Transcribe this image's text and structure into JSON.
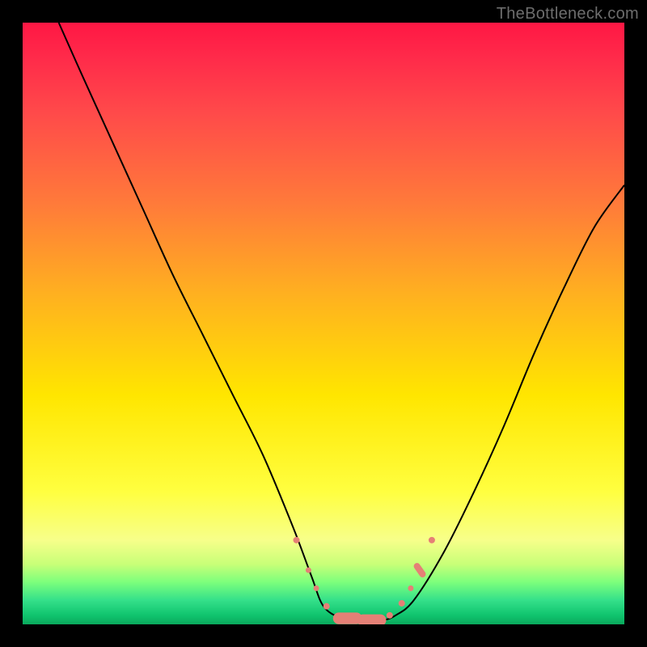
{
  "watermark": "TheBottleneck.com",
  "chart_data": {
    "type": "line",
    "title": "",
    "xlabel": "",
    "ylabel": "",
    "xlim": [
      0,
      100
    ],
    "ylim": [
      0,
      100
    ],
    "grid": false,
    "series": [
      {
        "name": "curve",
        "x": [
          6,
          10,
          15,
          20,
          25,
          30,
          35,
          40,
          45,
          48,
          50,
          53,
          56,
          58,
          60,
          62,
          65,
          70,
          75,
          80,
          85,
          90,
          95,
          100
        ],
        "y": [
          100,
          91,
          80,
          69,
          58,
          48,
          38,
          28,
          16,
          8,
          3,
          1,
          0.5,
          0.5,
          0.7,
          1.5,
          4,
          12,
          22,
          33,
          45,
          56,
          66,
          73
        ]
      }
    ],
    "markers": [
      {
        "x": 45.5,
        "y": 14,
        "size": 4
      },
      {
        "x": 47.5,
        "y": 9,
        "size": 3.5
      },
      {
        "x": 48.8,
        "y": 6,
        "size": 3.5
      },
      {
        "x": 50.5,
        "y": 3,
        "size": 4
      },
      {
        "x": 54,
        "y": 1,
        "size": 9,
        "elong": true
      },
      {
        "x": 58,
        "y": 0.7,
        "size": 9,
        "elong": true
      },
      {
        "x": 61,
        "y": 1.5,
        "size": 4
      },
      {
        "x": 63,
        "y": 3.5,
        "size": 4
      },
      {
        "x": 64.5,
        "y": 6,
        "size": 3.5
      },
      {
        "x": 66,
        "y": 9,
        "size": 5,
        "elong": true
      },
      {
        "x": 68,
        "y": 14,
        "size": 4
      }
    ],
    "background_gradient": {
      "top": "#ff1744",
      "mid": "#ffe600",
      "bottom": "#0aa85c"
    }
  }
}
